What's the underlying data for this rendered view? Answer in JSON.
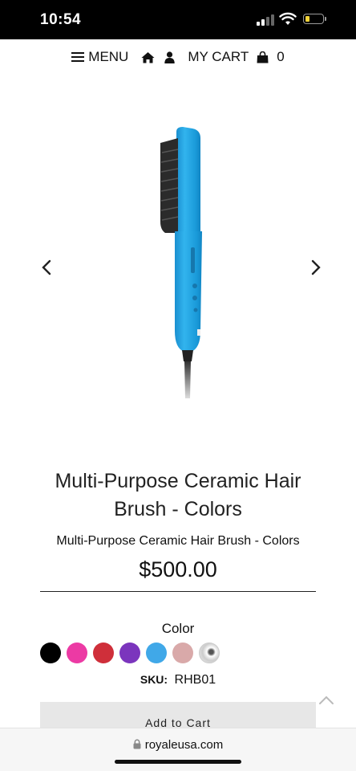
{
  "status_bar": {
    "time": "10:54",
    "battery_level": 0.2,
    "battery_color": "#f3d33a"
  },
  "nav": {
    "menu_label": "MENU",
    "home_icon": "home-icon",
    "account_icon": "user-icon",
    "cart_label": "MY CART",
    "cart_icon": "shopping-bag-icon",
    "cart_count": "0"
  },
  "carousel": {
    "prev_icon": "chevron-left-icon",
    "next_icon": "chevron-right-icon",
    "product_color": "#29a9e1"
  },
  "product": {
    "title": "Multi-Purpose Ceramic Hair Brush - Colors",
    "subtitle": "Multi-Purpose Ceramic Hair Brush - Colors",
    "price": "$500.00",
    "color_label": "Color",
    "swatches": [
      {
        "name": "black",
        "color": "#000000"
      },
      {
        "name": "pink",
        "color": "#ec3aa4"
      },
      {
        "name": "red",
        "color": "#cf2f3a"
      },
      {
        "name": "purple",
        "color": "#7b35bd"
      },
      {
        "name": "blue",
        "color": "#40a8e8"
      },
      {
        "name": "rose",
        "color": "#d9a9a9"
      },
      {
        "name": "marble",
        "color": "#e6e6e6"
      }
    ],
    "sku_label": "SKU:",
    "sku_value": "RHB01",
    "add_to_cart_label": "Add to Cart"
  },
  "browser": {
    "url": "royaleusa.com"
  }
}
